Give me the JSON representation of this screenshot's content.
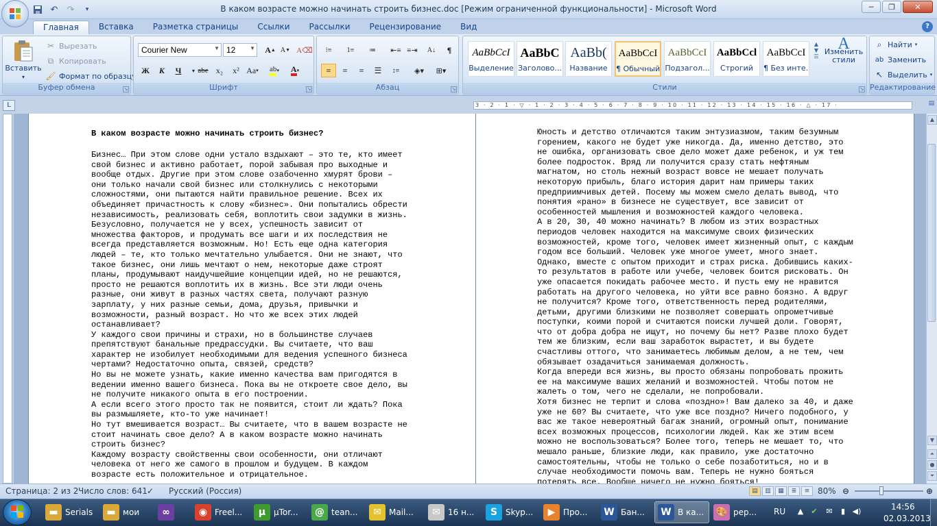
{
  "window": {
    "title": "В каком возрасте можно начинать строить бизнес.doc [Режим ограниченной функциональности] - Microsoft Word",
    "controls": [
      "minimize",
      "maximize",
      "close"
    ]
  },
  "qat": {
    "items": [
      "save-icon",
      "undo-icon",
      "redo-icon",
      "customize-icon"
    ]
  },
  "tabs": [
    "Главная",
    "Вставка",
    "Разметка страницы",
    "Ссылки",
    "Рассылки",
    "Рецензирование",
    "Вид"
  ],
  "active_tab": "Главная",
  "ribbon": {
    "clipboard": {
      "label": "Буфер обмена",
      "paste": "Вставить",
      "cut": "Вырезать",
      "copy": "Копировать",
      "format_painter": "Формат по образцу"
    },
    "font": {
      "label": "Шрифт",
      "font_name": "Courier New",
      "font_size": "12",
      "bold": "Ж",
      "italic": "К",
      "underline": "Ч",
      "strikethrough": "abe",
      "subscript": "x₂",
      "superscript": "x²",
      "change_case": "Aa",
      "grow": "A",
      "shrink": "A"
    },
    "paragraph": {
      "label": "Абзац"
    },
    "styles": {
      "label": "Стили",
      "items": [
        {
          "sample": "AaBbCcI",
          "name": "Выделение"
        },
        {
          "sample": "AaBbC",
          "name": "Заголово..."
        },
        {
          "sample": "AaBb(",
          "name": "Название"
        },
        {
          "sample": "AaBbCcI",
          "name": "¶ Обычный"
        },
        {
          "sample": "AaBbCcI",
          "name": "Подзагол..."
        },
        {
          "sample": "AaBbCcl",
          "name": "Строгий"
        },
        {
          "sample": "AaBbCcI",
          "name": "¶ Без инте..."
        }
      ],
      "change_styles": "Изменить стили"
    },
    "editing": {
      "label": "Редактирование",
      "find": "Найти",
      "replace": "Заменить",
      "select": "Выделить"
    }
  },
  "ruler": {
    "ticks": "3 · 2 · 1 · ▽ · 1 · 2 · 3 · 4 · 5 · 6 · 7 · 8 · 9 · 10 · 11 · 12 · 13 · 14 · 15 · 16 · △ · 17 ·"
  },
  "document": {
    "title": "В каком возрасте можно начинать строить бизнес?",
    "page1_text": "Бизнес… При этом слове одни устало вздыхают – это те, кто имеет\nсвой бизнес и активно работает, порой забывая про выходные и\nвообще отдых. Другие при этом слове озабоченно хмурят брови –\nони только начали свой бизнес или столкнулись с некоторыми\nсложностями, они пытаются найти правильное решение. Всех их\nобъединяет причастность к слову «бизнес». Они попытались обрести\nнезависимость, реализовать себя, воплотить свои задумки в жизнь.\nБезусловно, получается не у всех, успешность зависит от\nмножества факторов, и продумать все шаги и их последствия не\nвсегда представляется возможным. Но! Есть еще одна категория\nлюдей – те, кто только мечтательно улыбается. Они не знают, что\nтакое бизнес, они лишь мечтают о нем, некоторые даже строят\nпланы, продумывают наидучшейшие концепции идей, но не решаются,\nпросто не решаются воплотить их в жизнь. Все эти люди очень\nразные, они живут в разных частях света, получают разную\nзарплату, у них разные семьи, дома, друзья, привычки и\nвозможности, разный возраст. Но что же всех этих людей\nостанавливает?\nУ каждого свои причины и страхи, но в большинстве случаев\nпрепятствуют банальные предрассудки. Вы считаете, что ваш\nхарактер не изобилует необходимыми для ведения успешного бизнеса\nчертами? Недостаточно опыта, связей, средств?\nНо вы не можете узнать, какие именно качества вам пригодятся в\nведении именно вашего бизнеса. Пока вы не откроете свое дело, вы\nне получите никакого опыта в его построении.\nА если всего этого просто так не появится, стоит ли ждать? Пока\nвы размышляете, кто-то уже начинает!\nНо тут вмешивается возраст… Вы считаете, что в вашем возрасте не\nстоит начинать свое дело? А в каком возрасте можно начинать\nстроить бизнес?\nКаждому возрасту свойственны свои особенности, они отличают\nчеловека от него же самого в прошлом и будущем. В каждом\nвозрасте есть положительное и отрицательное.",
    "page2_text": "Юность и детство отличаются таким энтузиазмом, таким безумным\nгорением, какого не будет уже никогда. Да, именно детство, это\nне ошибка, организовать свое дело может даже ребенок, и уж тем\nболее подросток. Вряд ли получится сразу стать нефтяным\nмагнатом, но столь нежный возраст вовсе не мешает получать\nнекоторую прибыль, благо история дарит нам примеры таких\nпредприимчивых детей. Посему мы можем смело делать вывод, что\nпонятия «рано» в бизнесе не существует, все зависит от\nособенностей мышления и возможностей каждого человека.\nА в 20, 30, 40 можно начинать? В любом из этих возрастных\nпериодов человек находится на максимуме своих физических\nвозможностей, кроме того, человек имеет жизненный опыт, с каждым\nгодом все больший. Человек уже многое умеет, много знает.\nОднако, вместе с опытом приходит и страх риска. Добившись каких-\nто результатов в работе или учебе, человек боится рисковать. Он\nуже опасается покидать рабочее место. И пусть ему не нравится\nработать на другого человека, но уйти все равно боязно. А вдруг\nне получится? Кроме того, ответственность перед родителями,\nдетьми, другими близкими не позволяет совершать опрометчивые\nпоступки, коими порой и считаются поиски лучшей доли. Говорят,\nчто от добра добра не ищут, но почему бы нет? Разве плохо будет\nтем же близким, если ваш заработок вырастет, и вы будете\nсчастливы оттого, что занимаетесь любимым делом, а не тем, чем\nобязывает озадачиться занимаемая должность.\nКогда впереди вся жизнь, вы просто обязаны попробовать прожить\nее на максимуме ваших желаний и возможностей. Чтобы потом не\nжалеть о том, чего не сделали, не попробовали.\nХотя бизнес не терпит и слова «поздно»! Вам далеко за 40, и даже\nуже не 60? Вы считаете, что уже все поздно? Ничего подобного, у\nвас же такое невероятный багаж знаний, огромный опыт, понимание\nвсех возможных процессов, психологии людей. Как же этим всем\nможно не воспользоваться? Более того, теперь не мешает то, что\nмешало раньше, близкие люди, как правило, уже достаточно\nсамостоятельны, чтобы не только о себе позаботиться, но и в\nслучае необходимости помочь вам. Теперь не нужно бояться\nпотерять все. Вообще ничего не нужно бояться!"
  },
  "statusbar": {
    "page": "Страница: 2 из 2",
    "words": "Число слов: 641",
    "language": "Русский (Россия)",
    "zoom": "80%",
    "zoom_level": 0.8
  },
  "taskbar": {
    "items": [
      {
        "label": "Serials",
        "icon": "folder-icon",
        "color": "#d9a93a"
      },
      {
        "label": "мои",
        "icon": "folder-icon",
        "color": "#d9a93a"
      },
      {
        "label": "",
        "icon": "visual-studio-icon",
        "color": "#6a3fa0"
      },
      {
        "label": "Freel...",
        "icon": "chrome-icon",
        "color": "#d9412f"
      },
      {
        "label": "µTor...",
        "icon": "utorrent-icon",
        "color": "#3f9a2f"
      },
      {
        "label": "tean...",
        "icon": "icq-icon",
        "color": "#49a84a"
      },
      {
        "label": "Mail...",
        "icon": "mail-agent-icon",
        "color": "#e3c22e"
      },
      {
        "label": "16 н...",
        "icon": "envelope-icon",
        "color": "#c8c8c8"
      },
      {
        "label": "Skyp...",
        "icon": "skype-icon",
        "color": "#1aa1e0"
      },
      {
        "label": "Про...",
        "icon": "media-player-icon",
        "color": "#e8822c"
      },
      {
        "label": "Бан...",
        "icon": "word-doc-icon",
        "color": "#2b5797"
      },
      {
        "label": "В ка...",
        "icon": "word-doc-icon",
        "color": "#2b5797"
      },
      {
        "label": "рер...",
        "icon": "paint-icon",
        "color": "#c76fb0"
      }
    ],
    "language": "RU",
    "time": "14:56",
    "date": "02.03.2013"
  }
}
